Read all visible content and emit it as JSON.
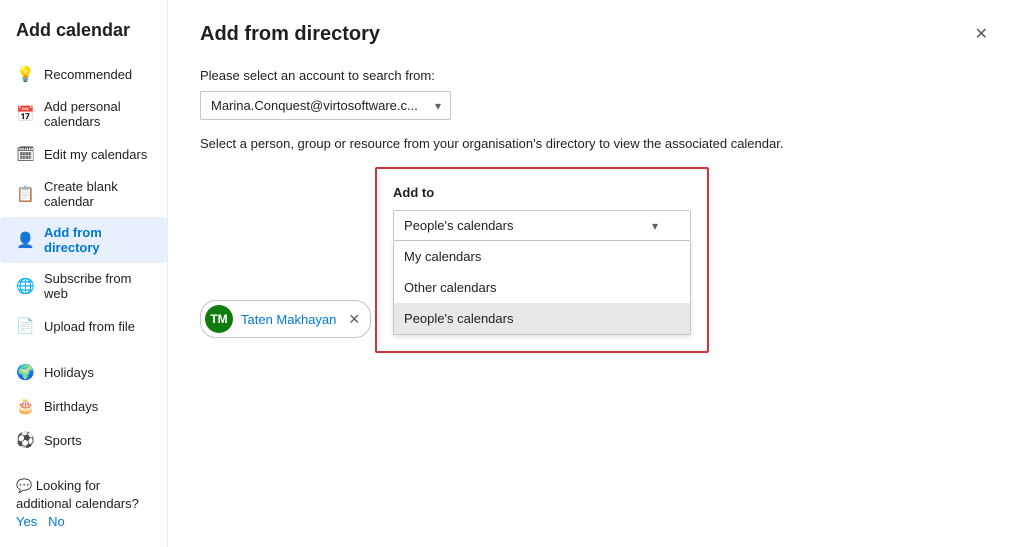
{
  "sidebar": {
    "title": "Add calendar",
    "items": [
      {
        "id": "recommended",
        "label": "Recommended",
        "icon": "💡",
        "active": false
      },
      {
        "id": "add-personal",
        "label": "Add personal calendars",
        "icon": "📅",
        "active": false
      },
      {
        "id": "edit-my",
        "label": "Edit my calendars",
        "icon": "🗓",
        "active": false
      },
      {
        "id": "create-blank",
        "label": "Create blank calendar",
        "icon": "📋",
        "active": false
      },
      {
        "id": "add-from-directory",
        "label": "Add from directory",
        "icon": "👤",
        "active": true
      },
      {
        "id": "subscribe-from-web",
        "label": "Subscribe from web",
        "icon": "🌐",
        "active": false
      },
      {
        "id": "upload-from-file",
        "label": "Upload from file",
        "icon": "📄",
        "active": false
      }
    ],
    "divider_items": [
      {
        "id": "holidays",
        "label": "Holidays",
        "icon": "🌍"
      },
      {
        "id": "birthdays",
        "label": "Birthdays",
        "icon": "🎂"
      },
      {
        "id": "sports",
        "label": "Sports",
        "icon": "⚽"
      }
    ],
    "footer": {
      "text": "Looking for additional calendars?",
      "yes_label": "Yes",
      "no_label": "No"
    }
  },
  "main": {
    "title": "Add from directory",
    "close_label": "✕",
    "account_label": "Please select an account to search from:",
    "account_value": "Marina.Conquest@virtosoftware.c...",
    "org_description": "Select a person, group or resource from your organisation's directory to view the associated calendar.",
    "person": {
      "initials": "TM",
      "name": "Taten Makhayan",
      "avatar_color": "#107c10"
    },
    "add_to": {
      "label": "Add to",
      "selected": "People's calendars",
      "options": [
        {
          "id": "my-calendars",
          "label": "My calendars"
        },
        {
          "id": "other-calendars",
          "label": "Other calendars"
        },
        {
          "id": "peoples-calendars",
          "label": "People's calendars",
          "selected": true
        }
      ]
    }
  }
}
